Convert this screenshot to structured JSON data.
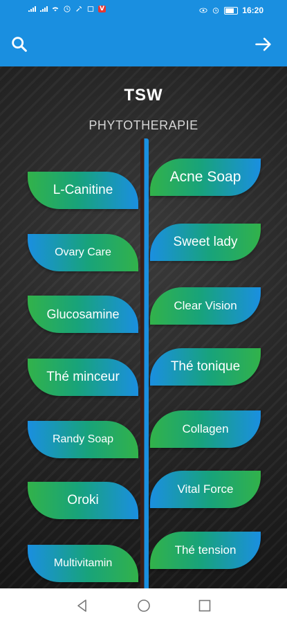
{
  "status_bar": {
    "time": "16:20",
    "badge": "V",
    "icons": [
      "signal-icon",
      "signal-icon",
      "wifi-icon",
      "alarm-icon",
      "wrench-icon",
      "gallery-icon",
      "vpn-icon",
      "eye-icon",
      "alarm-clock-icon",
      "battery-icon"
    ]
  },
  "app_bar": {
    "background": "#1a8fe0",
    "left_icon": "search-icon",
    "right_icon": "arrow-forward-icon"
  },
  "header": {
    "title": "TSW",
    "subtitle": "PHYTOTHERAPIE"
  },
  "products": {
    "left": [
      {
        "label": "L-Canitine"
      },
      {
        "label": "Ovary Care"
      },
      {
        "label": "Glucosamine"
      },
      {
        "label": "Thé minceur"
      },
      {
        "label": "Randy Soap"
      },
      {
        "label": "Oroki"
      },
      {
        "label": "Multivitamin"
      }
    ],
    "right": [
      {
        "label": "Acne Soap"
      },
      {
        "label": "Sweet lady"
      },
      {
        "label": "Clear Vision"
      },
      {
        "label": "Thé tonique"
      },
      {
        "label": "Collagen"
      },
      {
        "label": "Vital Force"
      },
      {
        "label": "Thé tension"
      }
    ]
  },
  "colors": {
    "accent_blue": "#1a8fe0",
    "leaf_green": "#32b24a",
    "stem_brown": "#3a1f18"
  },
  "nav_bar": {
    "buttons": [
      "back-icon",
      "home-icon",
      "recents-icon"
    ]
  }
}
